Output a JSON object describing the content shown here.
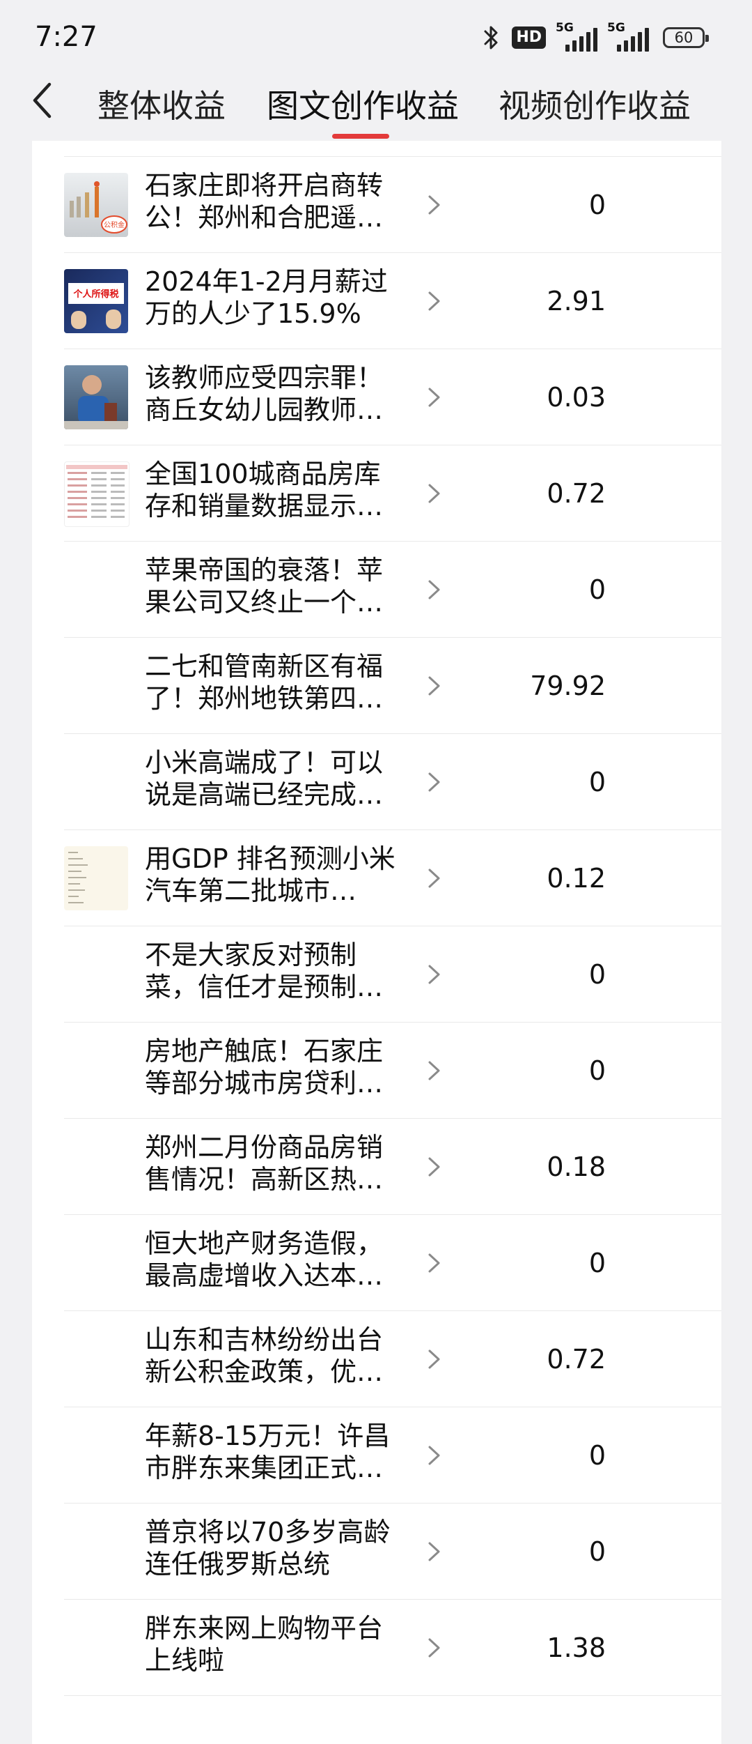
{
  "status_bar": {
    "time": "7:27",
    "hd_label": "HD",
    "signal_label": "5G",
    "battery": "60"
  },
  "header": {
    "tabs": [
      {
        "label": "整体收益",
        "active": false
      },
      {
        "label": "图文创作收益",
        "active": true
      },
      {
        "label": "视频创作收益",
        "active": false
      }
    ],
    "accent_color": "#e33a3a"
  },
  "items": [
    {
      "title": "石家庄即将开启商转公！郑州和合肥遥…",
      "value": "0",
      "thumbnail": "photo-thumbnail"
    },
    {
      "title": "2024年1-2月月薪过万的人少了15.9%",
      "value": "2.91",
      "thumbnail": "photo-thumbnail"
    },
    {
      "title": "该教师应受四宗罪！商丘女幼儿园教师…",
      "value": "0.03",
      "thumbnail": "photo-thumbnail"
    },
    {
      "title": "全国100城商品房库存和销量数据显示…",
      "value": "0.72",
      "thumbnail": "table-thumbnail"
    },
    {
      "title": "苹果帝国的衰落！苹果公司又终止一个…",
      "value": "0",
      "thumbnail": ""
    },
    {
      "title": "二七和管南新区有福了！郑州地铁第四…",
      "value": "79.92",
      "thumbnail": ""
    },
    {
      "title": "小米高端成了！可以说是高端已经完成…",
      "value": "0",
      "thumbnail": ""
    },
    {
      "title": "用GDP 排名预测小米汽车第二批城市…",
      "value": "0.12",
      "thumbnail": "list-thumbnail"
    },
    {
      "title": "不是大家反对预制菜，信任才是预制…",
      "value": "0",
      "thumbnail": ""
    },
    {
      "title": "房地产触底！石家庄等部分城市房贷利…",
      "value": "0",
      "thumbnail": ""
    },
    {
      "title": "郑州二月份商品房销售情况！高新区热…",
      "value": "0.18",
      "thumbnail": ""
    },
    {
      "title": "恒大地产财务造假，最高虚增收入达本…",
      "value": "0",
      "thumbnail": ""
    },
    {
      "title": "山东和吉林纷纷出台新公积金政策，优…",
      "value": "0.72",
      "thumbnail": ""
    },
    {
      "title": "年薪8-15万元！许昌市胖东来集团正式…",
      "value": "0",
      "thumbnail": ""
    },
    {
      "title": "普京将以70多岁高龄连任俄罗斯总统",
      "value": "0",
      "thumbnail": ""
    },
    {
      "title": "胖东来网上购物平台上线啦",
      "value": "1.38",
      "thumbnail": ""
    }
  ],
  "thumb_texts": {
    "item1": "公积金",
    "item2": "个人所得税"
  }
}
